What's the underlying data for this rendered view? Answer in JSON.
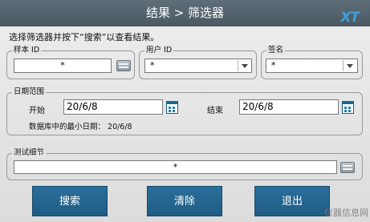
{
  "window": {
    "title": "结果 > 筛选器",
    "logo": "XT"
  },
  "instruction": "选择筛选器并按下“搜索”以查看结果。",
  "sample_id": {
    "legend": "样本 ID",
    "value": "*"
  },
  "user_id": {
    "legend": "用户 ID",
    "value": "*"
  },
  "signature": {
    "legend": "签名",
    "value": "*"
  },
  "date_range": {
    "legend": "日期范围",
    "start_label": "开始",
    "start_value": "20/6/8",
    "end_label": "结束",
    "end_value": "20/6/8",
    "min_date_text": "数据库中的最小日期：  20/6/8"
  },
  "test_details": {
    "legend": "测试细节",
    "value": "*"
  },
  "buttons": {
    "search": "搜索",
    "clear": "清除",
    "back": "退出"
  },
  "watermark": "仪器信息网"
}
